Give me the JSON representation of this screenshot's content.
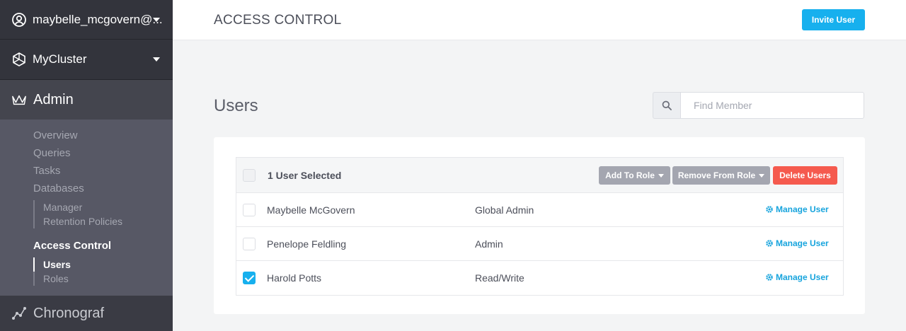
{
  "sidebar": {
    "account": "maybelle_mcgovern@...",
    "cluster": "MyCluster",
    "admin": "Admin",
    "admin_menu": {
      "overview": "Overview",
      "queries": "Queries",
      "tasks": "Tasks",
      "databases": "Databases",
      "databases_sub": [
        "Manager",
        "Retention Policies"
      ],
      "access_control": "Access Control",
      "access_sub": [
        "Users",
        "Roles"
      ]
    },
    "chronograf": "Chronograf"
  },
  "header": {
    "title": "ACCESS CONTROL",
    "invite_label": "Invite User"
  },
  "main": {
    "section_title": "Users",
    "search": {
      "placeholder": "Find Member",
      "value": ""
    },
    "selection_text": "1 User Selected",
    "actions": {
      "add_to_role": "Add To Role",
      "remove_from_role": "Remove From Role",
      "delete_users": "Delete Users"
    },
    "users": [
      {
        "name": "Maybelle McGovern",
        "role": "Global Admin",
        "action": "Manage User",
        "checked": false
      },
      {
        "name": "Penelope Feldling",
        "role": "Admin",
        "action": "Manage User",
        "checked": false
      },
      {
        "name": "Harold Potts",
        "role": "Read/Write",
        "action": "Manage User",
        "checked": true
      }
    ]
  },
  "colors": {
    "accent": "#17b0ee",
    "danger": "#f55a4e",
    "sidebar_bg": "#2d2e36"
  },
  "icons": {
    "account": "user-circle-icon",
    "cluster": "cluster-icon",
    "admin": "crown-icon",
    "chronograf": "graph-icon",
    "search": "search-icon",
    "manage": "gear-icon"
  }
}
